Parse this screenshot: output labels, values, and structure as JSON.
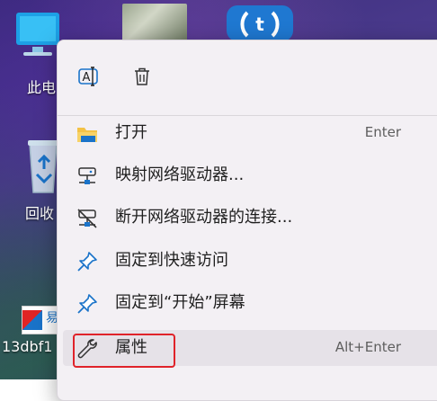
{
  "desktop": {
    "icons": [
      {
        "label": "此电"
      },
      {
        "label": "回收"
      },
      {
        "label": "13dbf1"
      },
      {
        "badge_text": "易"
      }
    ]
  },
  "context_menu": {
    "quick_actions": [
      {
        "icon": "rename-icon"
      },
      {
        "icon": "delete-icon"
      }
    ],
    "items": [
      {
        "label": "打开",
        "shortcut": "Enter",
        "icon": "folder-icon"
      },
      {
        "label": "映射网络驱动器...",
        "shortcut": "",
        "icon": "network-drive-icon"
      },
      {
        "label": "断开网络驱动器的连接...",
        "shortcut": "",
        "icon": "disconnect-drive-icon"
      },
      {
        "label": "固定到快速访问",
        "shortcut": "",
        "icon": "pin-icon"
      },
      {
        "label": "固定到“开始”屏幕",
        "shortcut": "",
        "icon": "pin-icon"
      },
      {
        "label": "属性",
        "shortcut": "Alt+Enter",
        "icon": "wrench-icon"
      }
    ]
  },
  "colors": {
    "highlight_border": "#e0232a",
    "pin_blue": "#1a73c9",
    "folder_yellow": "#f3c246"
  }
}
